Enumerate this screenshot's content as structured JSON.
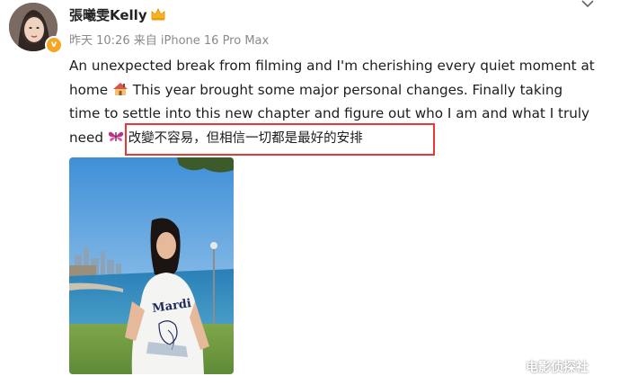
{
  "post": {
    "username": "張曦雯Kelly",
    "timestamp": "昨天 10:26",
    "source": "来自 iPhone 16 Pro Max",
    "text_line1": "An unexpected break from filming and I'm cherishing every quiet moment at",
    "text_line2a": "home",
    "text_line2b": "This year brought some major personal changes. Finally taking",
    "text_line3": "time to settle into this new chapter and figure out who I am and what I truly",
    "text_line4a": "need",
    "text_line4b": "改變不容易，但相信一切都是最好的安排",
    "photo_shirt_text": "Mardi"
  },
  "icons": {
    "verified": "verified-badge-icon",
    "crown": "crown-member-icon",
    "house": "house-emoji-icon",
    "butterfly": "butterfly-emoji-icon",
    "more": "chevron-down-icon"
  },
  "colors": {
    "highlight": "#e53935",
    "verified": "#f5a623",
    "meta_text": "#8a8a8a"
  },
  "watermark": "电影侦探社"
}
